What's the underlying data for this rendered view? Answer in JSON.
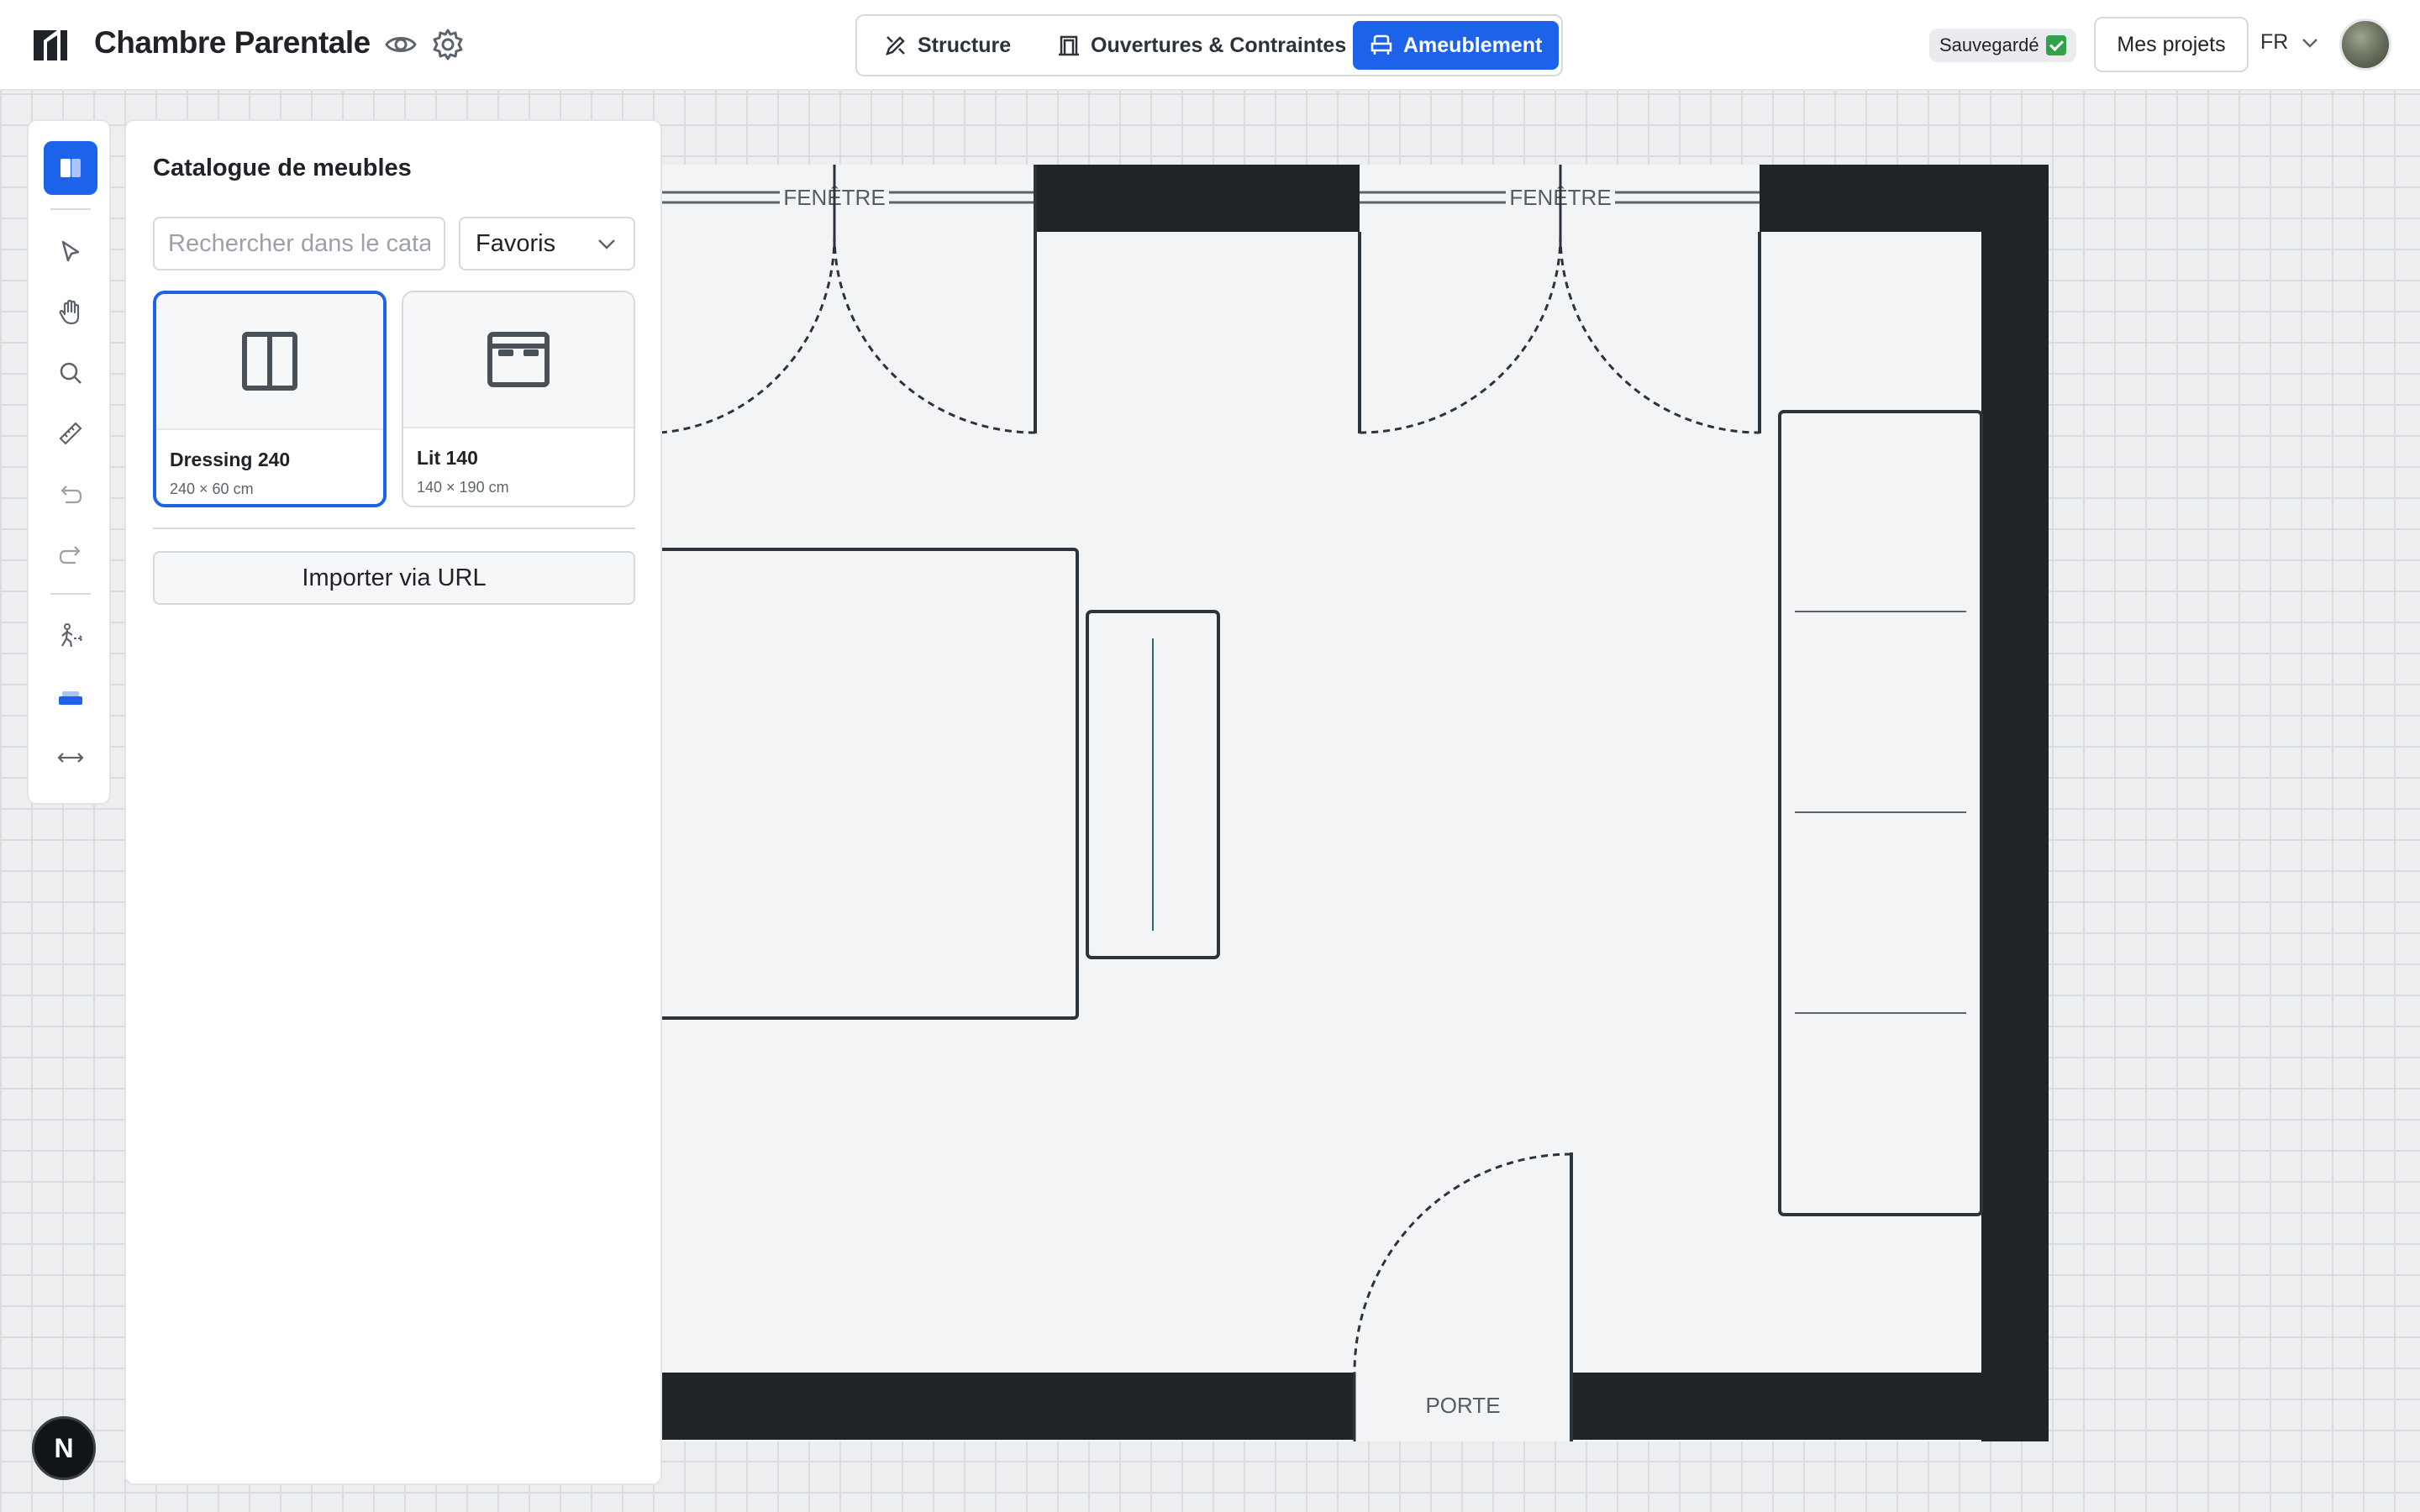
{
  "header": {
    "title": "Chambre Parentale",
    "tabs": [
      {
        "label": "Structure",
        "icon": "pencil-ruler-icon"
      },
      {
        "label": "Ouvertures & Contraintes",
        "icon": "window-frame-icon"
      },
      {
        "label": "Ameublement",
        "icon": "armchair-icon",
        "active": true
      }
    ],
    "save_status": "Sauvegardé",
    "projects_label": "Mes projets",
    "language": "FR"
  },
  "toolbar": {
    "tools": [
      "catalog-icon",
      "select-cursor-icon",
      "hand-pan-icon",
      "zoom-icon",
      "ruler-icon",
      "undo-icon",
      "redo-icon",
      "walk-path-icon",
      "sofa-icon",
      "horizontal-resize-icon"
    ],
    "active_tool": "catalog-icon"
  },
  "catalogue": {
    "title": "Catalogue de meubles",
    "search_placeholder": "Rechercher dans le catalogue",
    "filter_selected": "Favoris",
    "items": [
      {
        "name": "Dressing 240",
        "dims": "240 × 60 cm",
        "selected": true
      },
      {
        "name": "Lit 140",
        "dims": "140 × 190 cm",
        "selected": false
      }
    ],
    "import_label": "Importer via URL"
  },
  "plan": {
    "window_label_1": "FENÊTRE",
    "window_label_2": "FENÊTRE",
    "door_label": "PORTE"
  },
  "badge": "N",
  "colors": {
    "accent": "#1d63ea",
    "wall": "#1f2429",
    "floor": "#f3f4f6",
    "saved_check": "#2fa24a"
  }
}
